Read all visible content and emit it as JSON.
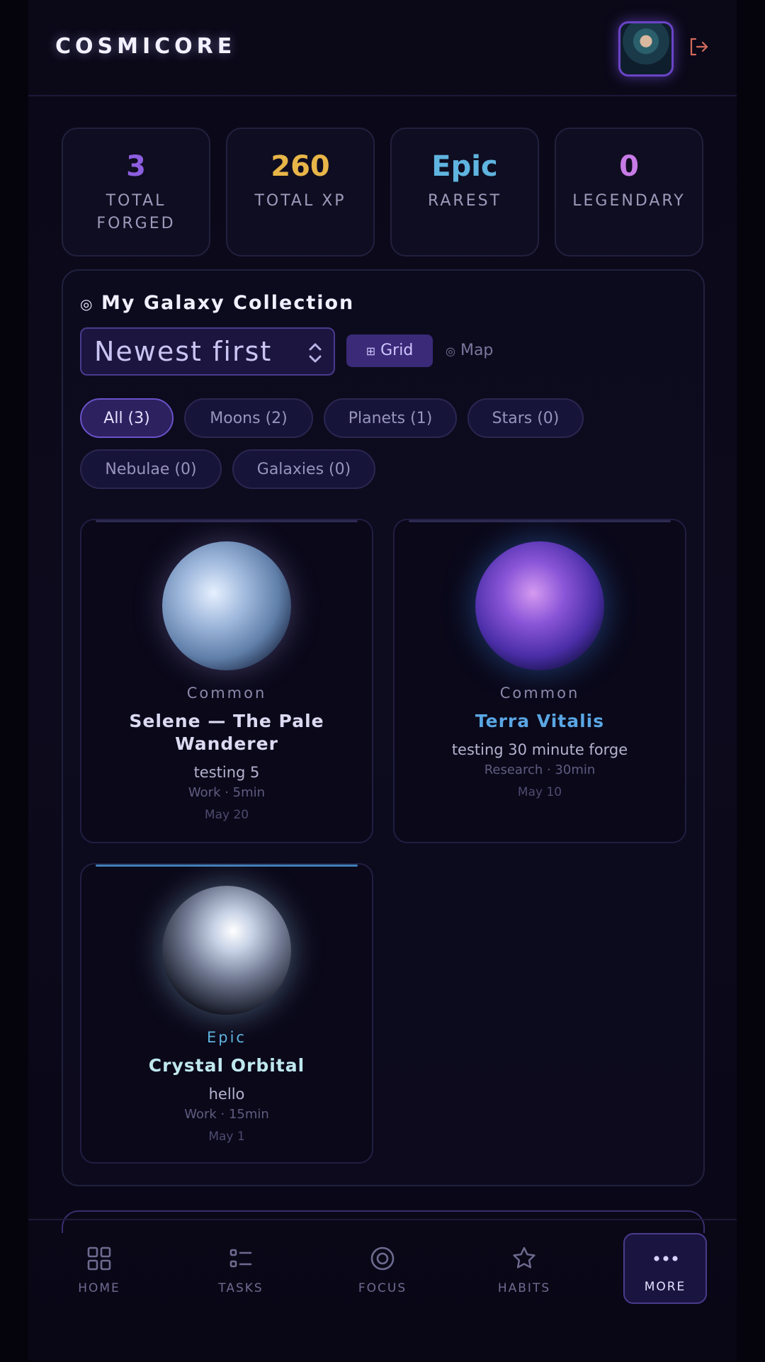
{
  "header": {
    "logo": "COSMICORE"
  },
  "stats": [
    {
      "value": "3",
      "label": "TOTAL FORGED",
      "color": "#8d5ee0"
    },
    {
      "value": "260",
      "label": "TOTAL XP",
      "color": "#e8b548"
    },
    {
      "value": "Epic",
      "label": "RAREST",
      "color": "#5fb4e0"
    },
    {
      "value": "0",
      "label": "LEGENDARY",
      "color": "#c77be6"
    }
  ],
  "collection": {
    "title": "My Galaxy Collection",
    "sort_value": "Newest first",
    "view_grid": "Grid",
    "view_map": "Map",
    "filters": [
      "All (3)",
      "Moons (2)",
      "Planets (1)",
      "Stars (0)",
      "Nebulae (0)",
      "Galaxies (0)"
    ],
    "items": [
      {
        "rarity": "Common",
        "name": "Selene — The Pale Wanderer",
        "description": "testing 5",
        "meta": "Work · 5min",
        "date": "May 20",
        "name_color": "#dcdaf2",
        "rarity_color": "#8b88aa"
      },
      {
        "rarity": "Common",
        "name": "Terra Vitalis",
        "description": "testing 30 minute forge",
        "meta": "Research · 30min",
        "date": "May 10",
        "name_color": "#5aa6e4",
        "rarity_color": "#8b88aa"
      },
      {
        "rarity": "Epic",
        "name": "Crystal Orbital",
        "description": "hello",
        "meta": "Work · 15min",
        "date": "May 1",
        "name_color": "#bfe8ee",
        "rarity_color": "#5fb4e0"
      }
    ]
  },
  "nav": [
    {
      "label": "HOME",
      "icon": "grid-icon"
    },
    {
      "label": "TASKS",
      "icon": "list-icon"
    },
    {
      "label": "FOCUS",
      "icon": "target-icon"
    },
    {
      "label": "HABITS",
      "icon": "star-icon"
    },
    {
      "label": "MORE",
      "icon": "dots-icon"
    }
  ]
}
